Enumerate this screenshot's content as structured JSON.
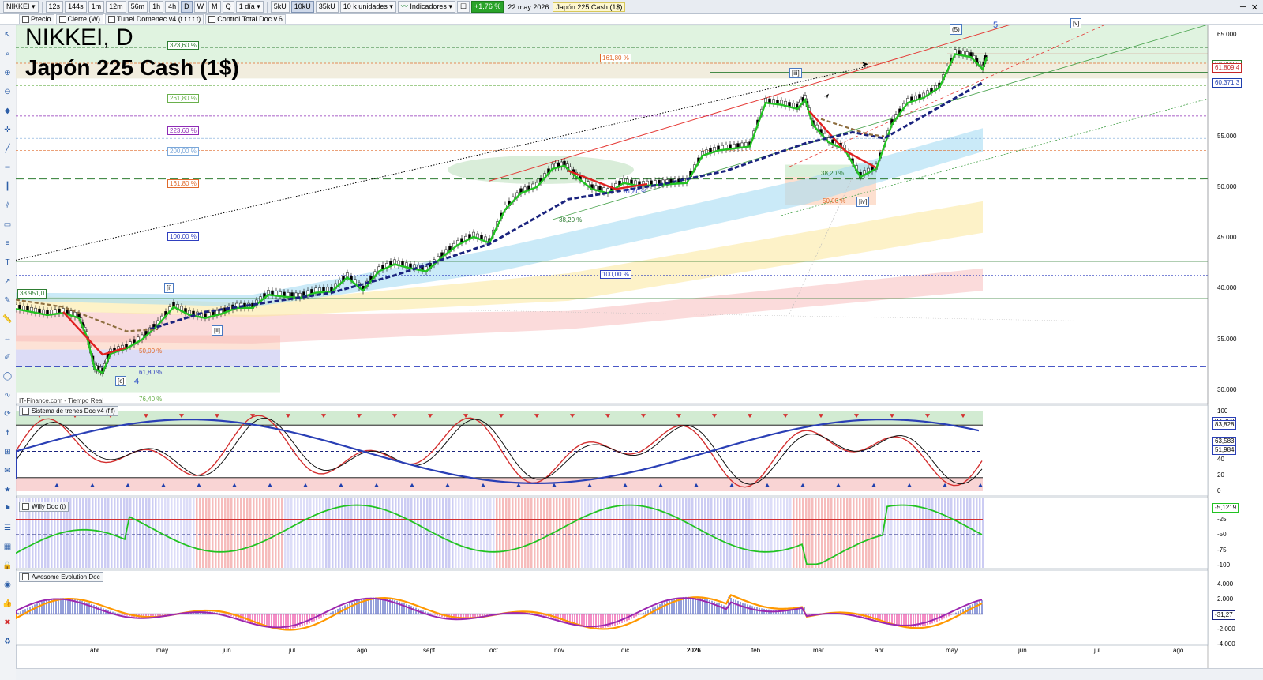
{
  "toolbar": {
    "symbol": "NIKKEI",
    "timeframes": [
      "12s",
      "144s",
      "1m",
      "12m",
      "56m",
      "1h",
      "4h",
      "D",
      "W",
      "M",
      "Q"
    ],
    "active_timeframe": "D",
    "period": "1 día",
    "units_buttons": [
      "5kU",
      "10kU",
      "35kU"
    ],
    "active_unit": "10kU",
    "units_select": "10 k unidades",
    "indicators_label": "Indicadores",
    "change": "+1,76 %",
    "date": "22 may 2026",
    "instrument": "Japón 225 Cash (1$)"
  },
  "toolbar2": {
    "items": [
      "Precio",
      "Cierre (W)",
      "Tunel Domenec v4 (t t t t t)",
      "Control Total Doc v.6"
    ]
  },
  "main": {
    "title": "NIKKEI, D",
    "subtitle": "Japón 225 Cash (1$)",
    "source": "IT-Finance.com - Tiempo Real",
    "price_axis": [
      "65.000",
      "60.000",
      "55.000",
      "50.000",
      "45.000",
      "40.000",
      "35.000",
      "30.000"
    ],
    "price_tags": [
      {
        "label": "62.089,2",
        "color": "#2e7d32"
      },
      {
        "label": "61.809,4",
        "color": "#c62828"
      },
      {
        "label": "60.371,3",
        "color": "#1f3fae"
      }
    ],
    "left_tag": "38.951,0",
    "fib_labels": [
      {
        "label": "323,60 %",
        "color": "#2e7d32"
      },
      {
        "label": "161,80 %",
        "color": "#e06a2a"
      },
      {
        "label": "261,80 %",
        "color": "#6ab04c"
      },
      {
        "label": "223,60 %",
        "color": "#8e2bb5"
      },
      {
        "label": "200,00 %",
        "color": "#7aa7d9"
      },
      {
        "label": "161,80 %",
        "color": "#e06a2a"
      },
      {
        "label": "100,00 %",
        "color": "#2f3fbf"
      },
      {
        "label": "100,00 %",
        "color": "#2f3fbf"
      },
      {
        "label": "38,20 %",
        "color": "#2e7d32"
      },
      {
        "label": "61,80 %",
        "color": "#2f3fbf"
      },
      {
        "label": "38,20 %",
        "color": "#2e7d32"
      },
      {
        "label": "50,00 %",
        "color": "#e06a2a"
      },
      {
        "label": "50,00 %",
        "color": "#e06a2a"
      },
      {
        "label": "61,80 %",
        "color": "#2f3fbf"
      },
      {
        "label": "76,40 %",
        "color": "#6ab04c"
      }
    ],
    "wave_labels": [
      "(5)",
      "[v]",
      "[iii]",
      "[iv]",
      "[i]",
      "[ii]",
      "[c]"
    ],
    "wave_numbers": [
      "5",
      "4"
    ]
  },
  "panels": [
    {
      "title": "Sistema de trenes Doc v4 (f f)",
      "axis": [
        "100",
        "80",
        "60",
        "40",
        "20",
        "0"
      ],
      "tags": [
        "87,769",
        "83,828",
        "63,583",
        "51,984"
      ]
    },
    {
      "title": "Willy Doc (t)",
      "axis": [
        "-25",
        "-50",
        "-75",
        "-100"
      ],
      "tags": [
        "-5,1219"
      ]
    },
    {
      "title": "Awesome Evolution Doc",
      "axis": [
        "4.000",
        "2.000",
        "-2.000",
        "-4.000"
      ],
      "tags": [
        "-31,27"
      ]
    }
  ],
  "time_axis": [
    "abr",
    "may",
    "jun",
    "jul",
    "ago",
    "sept",
    "oct",
    "nov",
    "dic",
    "2026",
    "feb",
    "mar",
    "abr",
    "may",
    "jun",
    "jul",
    "ago"
  ],
  "colors": {
    "up": "#1fbf1f",
    "down": "#e02020",
    "ma": "#1a237e",
    "bg_panel": "#ffffff"
  }
}
